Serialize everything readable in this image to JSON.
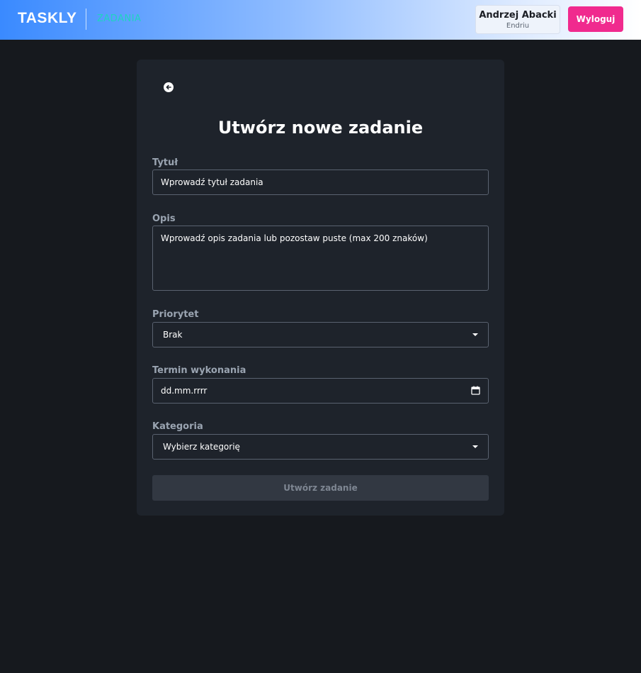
{
  "header": {
    "logo": "TASKLY",
    "nav_link": "ZADANIA",
    "user_name": "Andrzej Abacki",
    "user_nick": "Endriu",
    "logout_label": "Wyloguj"
  },
  "form": {
    "back_icon": "back-arrow-icon",
    "title": "Utwórz nowe zadanie",
    "title_label": "Tytuł",
    "title_placeholder": "Wprowadź tytuł zadania",
    "description_label": "Opis",
    "description_placeholder": "Wprowadź opis zadania lub pozostaw puste (max 200 znaków)",
    "priority_label": "Priorytet",
    "priority_value": "Brak",
    "due_label": "Termin wykonania",
    "due_placeholder": "dd.mm.rrrr",
    "category_label": "Kategoria",
    "category_value": "Wybierz kategorię",
    "submit_label": "Utwórz zadanie"
  },
  "colors": {
    "background": "#16191e",
    "card": "#1e232b",
    "accent_pink": "#f02a8e",
    "nav_teal": "#1fd3c1",
    "header_gradient_start": "#3a8aff"
  }
}
